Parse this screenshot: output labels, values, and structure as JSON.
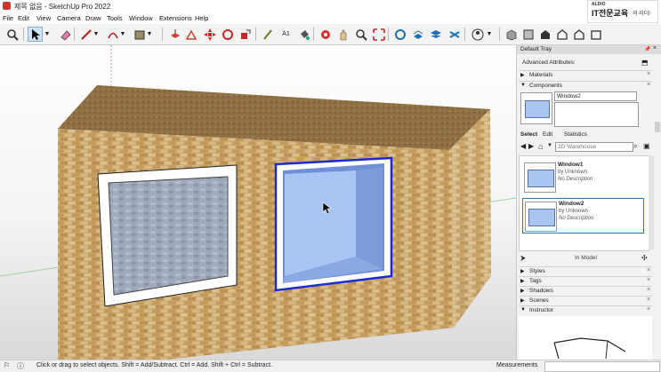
{
  "window": {
    "title": "제목 없음 - SketchUp Pro 2022"
  },
  "menu": [
    "File",
    "Edit",
    "View",
    "Camera",
    "Draw",
    "Tools",
    "Window",
    "Extensions",
    "Help"
  ],
  "logo": {
    "top": "ALDIO",
    "main": "IT전문교육",
    "sub": "의 리더!"
  },
  "tray": {
    "title": "Default Tray",
    "advanced": "Advanced Attributes:",
    "materials": "Materials",
    "components": "Components",
    "component_name": "Window2",
    "tabs": [
      "Select",
      "Edit",
      "Statistics"
    ],
    "search_placeholder": "3D Warehouse",
    "items": [
      {
        "name": "Window1",
        "by": "by Unknown",
        "desc": "No Description"
      },
      {
        "name": "Window2",
        "by": "by Unknown",
        "desc": "No Description"
      }
    ],
    "in_model": "In Model",
    "sections": [
      "Styles",
      "Tags",
      "Shadows",
      "Scenes",
      "Instructor"
    ]
  },
  "status": {
    "hint": "Click or drag to select objects. Shift = Add/Subtract. Ctrl = Add. Shift + Ctrl = Subtract.",
    "measurements_label": "Measurements"
  },
  "colors": {
    "selection": "#1a2bd0",
    "accent": "#2b78c6"
  }
}
